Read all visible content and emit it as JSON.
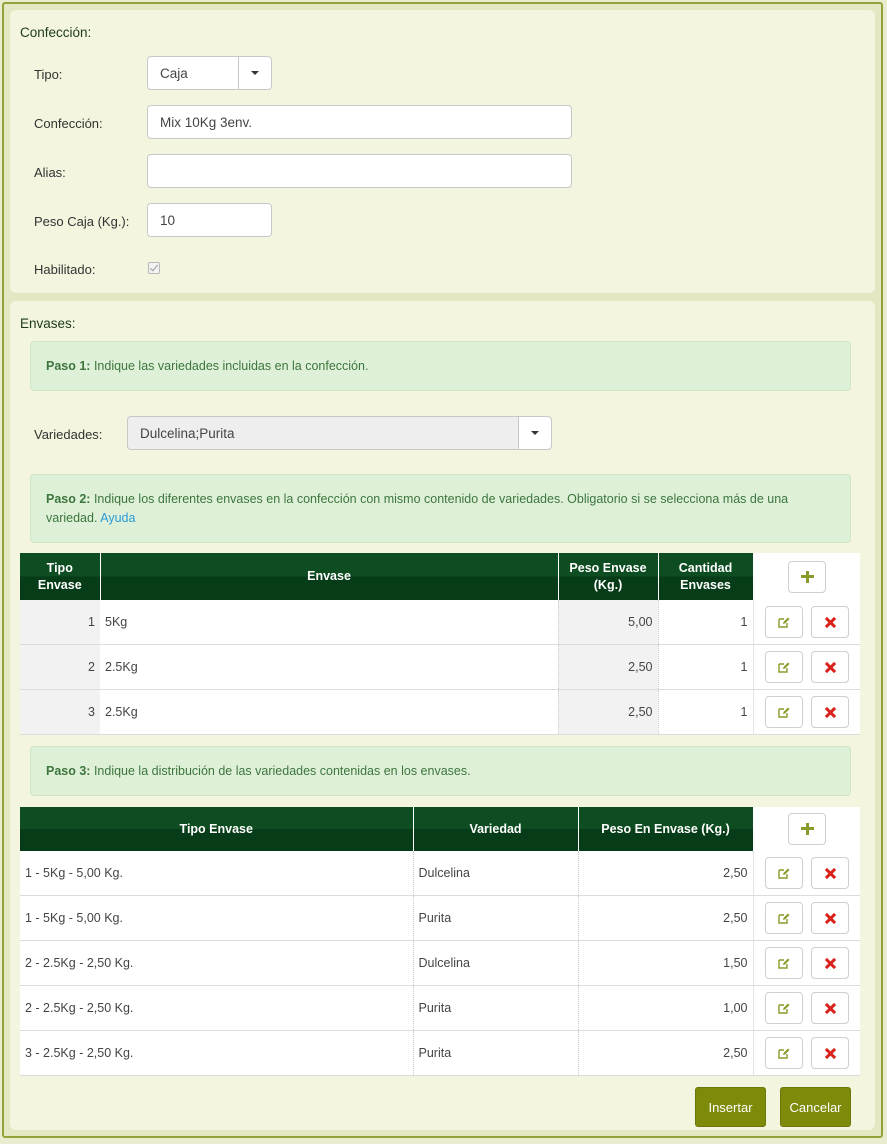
{
  "confeccion_section": {
    "title": "Confección:",
    "tipo": {
      "label": "Tipo:",
      "value": "Caja"
    },
    "confeccion": {
      "label": "Confección:",
      "value": "Mix 10Kg 3env."
    },
    "alias": {
      "label": "Alias:",
      "value": ""
    },
    "peso_caja": {
      "label": "Peso Caja (Kg.):",
      "value": "10"
    },
    "habilitado": {
      "label": "Habilitado:",
      "checked": true
    }
  },
  "envases_section": {
    "title": "Envases:",
    "paso1": {
      "bold": "Paso 1:",
      "text": " Indique las variedades incluidas en la confección."
    },
    "variedades": {
      "label": "Variedades:",
      "value": "Dulcelina;Purita"
    },
    "paso2": {
      "bold": "Paso 2:",
      "text": " Indique los diferentes envases en la confección con mismo contenido de variedades. Obligatorio si se selecciona más de una variedad. ",
      "link": "Ayuda"
    },
    "paso3": {
      "bold": "Paso 3:",
      "text": " Indique la distribución de las variedades contenidas en los envases."
    }
  },
  "table1": {
    "headers": {
      "tipo_l1": "Tipo",
      "tipo_l2": "Envase",
      "envase": "Envase",
      "peso_l1": "Peso Envase",
      "peso_l2": "(Kg.)",
      "cant_l1": "Cantidad",
      "cant_l2": "Envases"
    },
    "rows": [
      {
        "tipo": "1",
        "envase": "5Kg",
        "peso": "5,00",
        "cantidad": "1"
      },
      {
        "tipo": "2",
        "envase": "2.5Kg",
        "peso": "2,50",
        "cantidad": "1"
      },
      {
        "tipo": "3",
        "envase": "2.5Kg",
        "peso": "2,50",
        "cantidad": "1"
      }
    ]
  },
  "table2": {
    "headers": {
      "tipo_envase": "Tipo Envase",
      "variedad": "Variedad",
      "peso": "Peso En Envase (Kg.)"
    },
    "rows": [
      {
        "tipo_envase": "1 - 5Kg - 5,00 Kg.",
        "variedad": "Dulcelina",
        "peso": "2,50"
      },
      {
        "tipo_envase": "1 - 5Kg - 5,00 Kg.",
        "variedad": "Purita",
        "peso": "2,50"
      },
      {
        "tipo_envase": "2 - 2.5Kg - 2,50 Kg.",
        "variedad": "Dulcelina",
        "peso": "1,50"
      },
      {
        "tipo_envase": "2 - 2.5Kg - 2,50 Kg.",
        "variedad": "Purita",
        "peso": "1,00"
      },
      {
        "tipo_envase": "3 - 2.5Kg - 2,50 Kg.",
        "variedad": "Purita",
        "peso": "2,50"
      }
    ]
  },
  "buttons": {
    "insertar": "Insertar",
    "cancelar": "Cancelar"
  },
  "colors": {
    "header_green": "#0e4d22",
    "button_olive": "#7d8a0a",
    "delete_red": "#d9221c",
    "alert_bg": "#dff0d8"
  }
}
